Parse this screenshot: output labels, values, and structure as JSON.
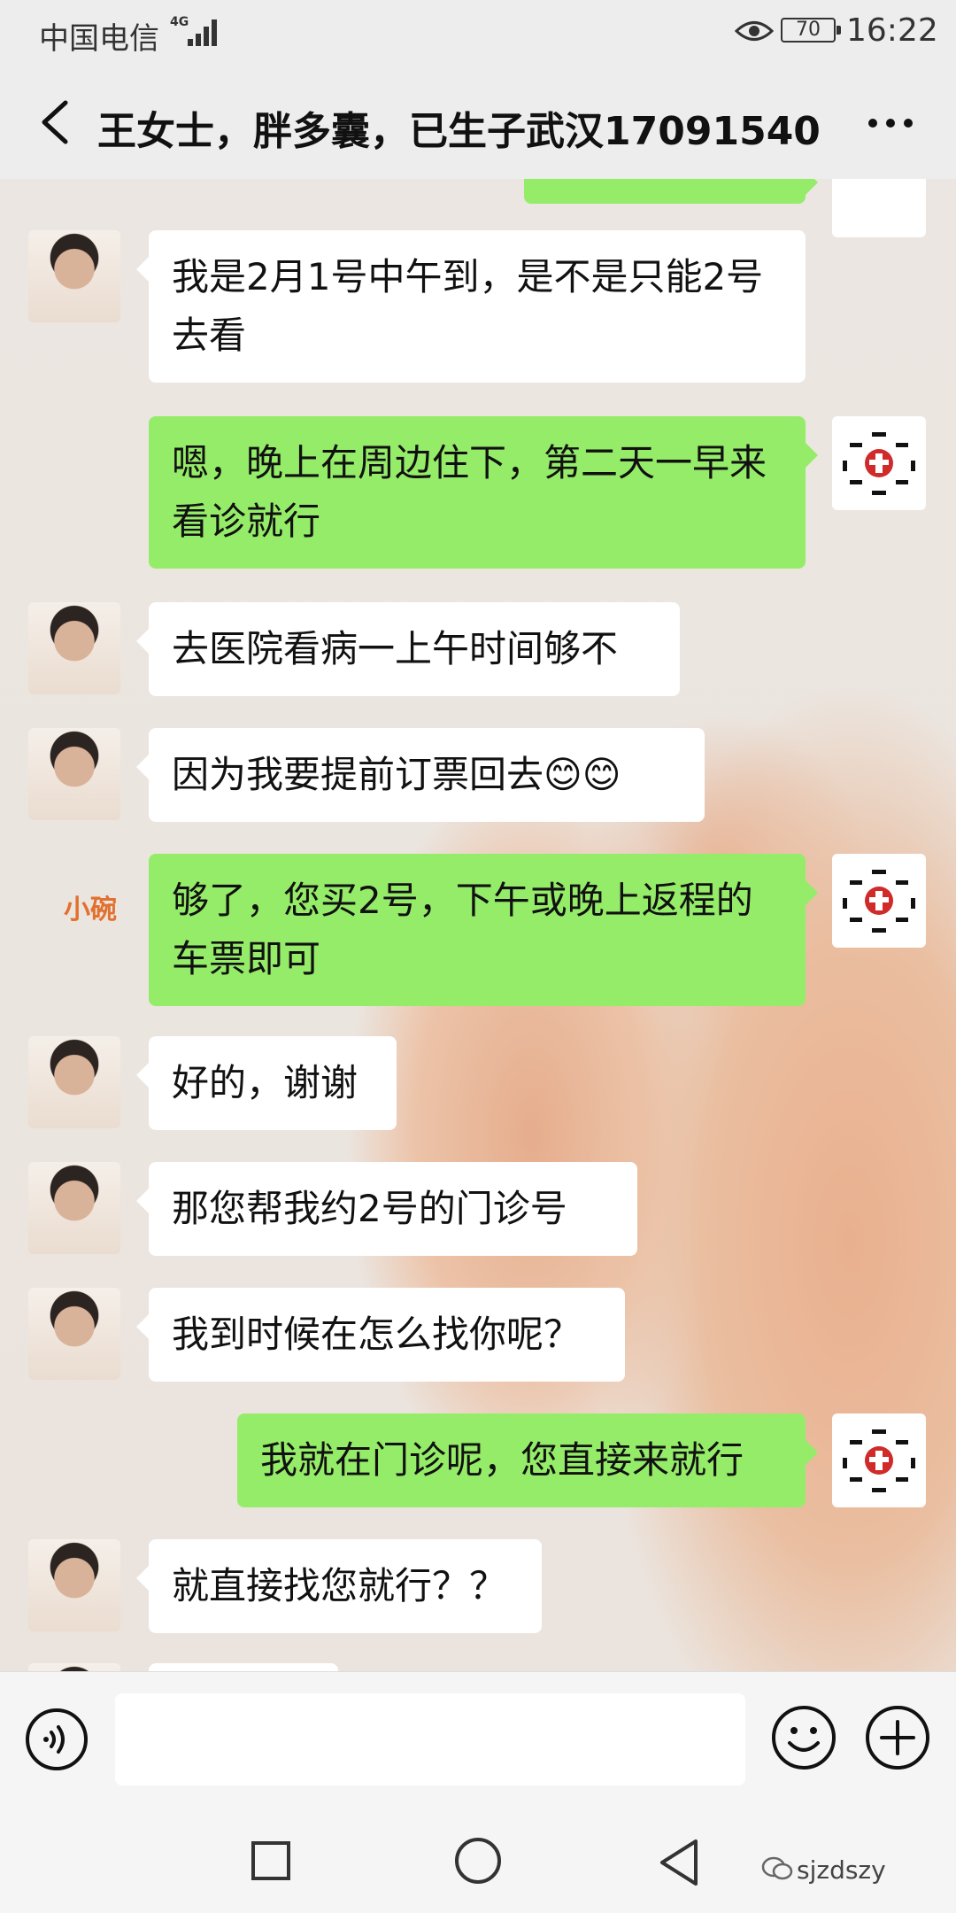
{
  "status_bar": {
    "carrier": "中国电信",
    "network": "4G",
    "battery": "70",
    "time": "16:22"
  },
  "header": {
    "title": "王女士，胖多囊，已生子武汉17091540"
  },
  "messages": [
    {
      "side": "left",
      "text": "我是2月1号中午到，是不是只能2号去看"
    },
    {
      "side": "right",
      "text": "嗯，晚上在周边住下，第二天一早来看诊就行"
    },
    {
      "side": "left",
      "text": "去医院看病一上午时间够不"
    },
    {
      "side": "left",
      "text": "因为我要提前订票回去😊😊"
    },
    {
      "side": "right",
      "text": "够了，您买2号，下午或晚上返程的车票即可"
    },
    {
      "side": "left",
      "text": "好的，谢谢"
    },
    {
      "side": "left",
      "text": "那您帮我约2号的门诊号"
    },
    {
      "side": "left",
      "text": "我到时候在怎么找你呢？"
    },
    {
      "side": "right",
      "text": "我就在门诊呢，您直接来就行"
    },
    {
      "side": "left",
      "text": "就直接找您就行？？"
    }
  ],
  "watermarks": {
    "background_mark": "小碗",
    "account": "sjzdszy"
  },
  "colors": {
    "bubble_right": "#95ec69",
    "bubble_left": "#ffffff",
    "header_bg": "#ededed"
  },
  "icons": [
    "back-icon",
    "more-icon",
    "voice-icon",
    "emoji-icon",
    "plus-icon",
    "recent-apps-icon",
    "home-icon",
    "back-nav-icon",
    "wechat-icon"
  ]
}
